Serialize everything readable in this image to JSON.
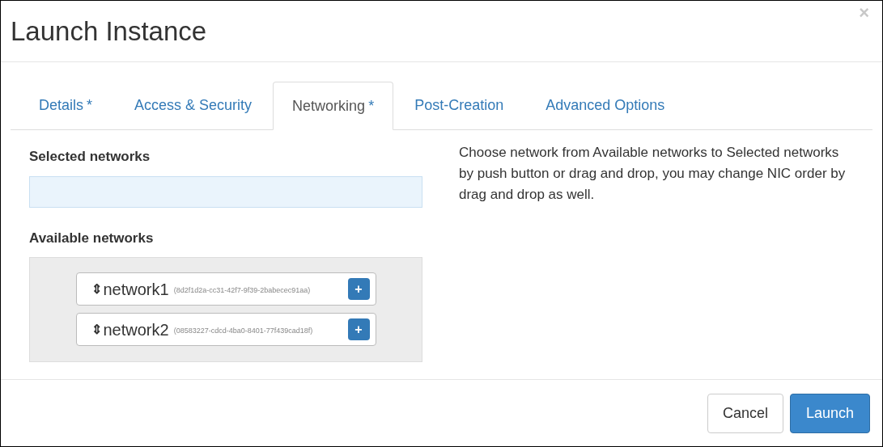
{
  "window": {
    "title": "Launch Instance",
    "close": "×"
  },
  "tabs": [
    {
      "label": "Details",
      "marker": "*",
      "selected": false
    },
    {
      "label": "Access & Security",
      "selected": false
    },
    {
      "label": "Networking",
      "marker": "*",
      "selected": true
    },
    {
      "label": "Post-Creation",
      "selected": false
    },
    {
      "label": "Advanced Options",
      "selected": false
    }
  ],
  "selected_networks": {
    "label": "Selected networks"
  },
  "available_networks": {
    "label": "Available networks",
    "items": [
      {
        "handle": "⇕",
        "name": "network1",
        "id": "(8d2f1d2a-cc31-42f7-9f39-2babecec91aa)",
        "button": "+"
      },
      {
        "handle": "⇕",
        "name": "network2",
        "id": "(08583227-cdcd-4ba0-8401-77f439cad18f)",
        "button": "+"
      }
    ]
  },
  "help": "Choose network from Available networks to Selected networks by push button or drag and drop, you may change NIC order by drag and drop as well.",
  "buttons": [
    {
      "label": "Cancel",
      "kind": "default"
    },
    {
      "label": "Launch",
      "kind": "primary"
    }
  ]
}
